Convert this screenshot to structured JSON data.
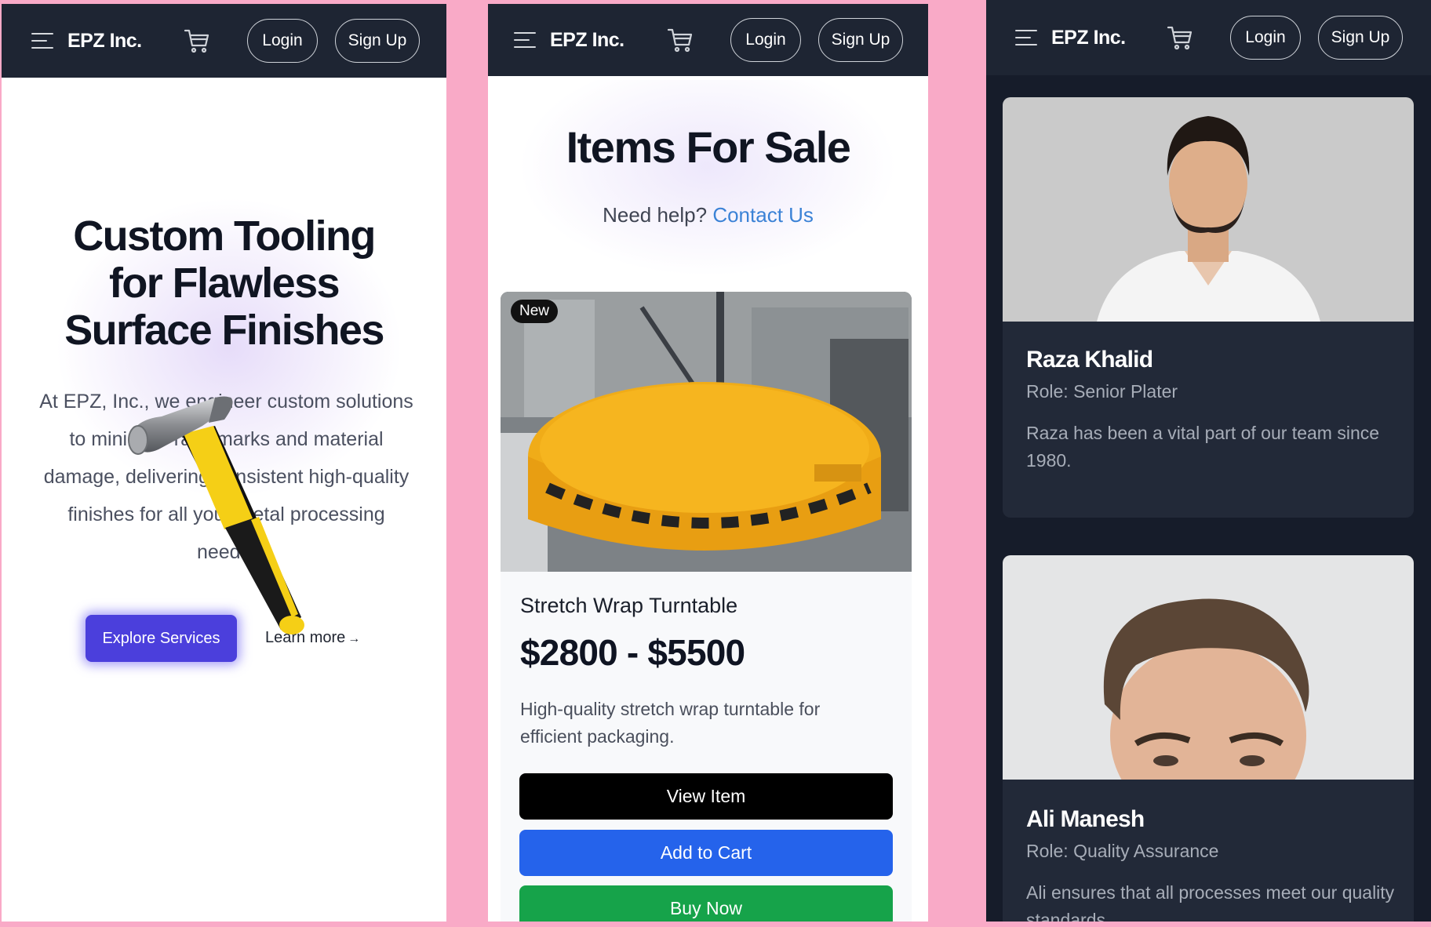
{
  "nav": {
    "brand": "EPZ Inc.",
    "login_label": "Login",
    "signup_label": "Sign Up",
    "menu_icon": "hamburger-menu-icon",
    "cart_icon": "shopping-cart-icon"
  },
  "hero": {
    "title": "Custom Tooling for Flawless Surface Finishes",
    "description": "At EPZ, Inc., we engineer custom solutions to minimize rack marks and material damage, delivering consistent high-quality finishes for all your metal processing needs.",
    "primary_button": "Explore Services",
    "secondary_link": "Learn more",
    "secondary_arrow": "→",
    "image": "hammer"
  },
  "shop": {
    "title": "Items For Sale",
    "help_text": "Need help?",
    "help_link": "Contact Us",
    "item": {
      "badge": "New",
      "name": "Stretch Wrap Turntable",
      "price": "$2800 - $5500",
      "description": "High-quality stretch wrap turntable for efficient packaging.",
      "view_button": "View Item",
      "cart_button": "Add to Cart",
      "buy_button": "Buy Now"
    }
  },
  "team": [
    {
      "name": "Raza Khalid",
      "role": "Role: Senior Plater",
      "bio": "Raza has been a vital part of our team since 1980."
    },
    {
      "name": "Ali Manesh",
      "role": "Role: Quality Assurance",
      "bio": "Ali ensures that all processes meet our quality standards."
    }
  ],
  "colors": {
    "nav_bg": "#1e2533",
    "separator_pink": "#f9aac7",
    "explore_button": "#4b3fdc",
    "link_blue": "#3b82d6",
    "cart_button": "#2563eb",
    "buy_button": "#16a34a",
    "team_bg": "#161c2a",
    "team_card": "#222938"
  }
}
